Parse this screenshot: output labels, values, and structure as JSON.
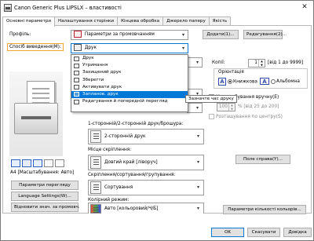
{
  "window": {
    "title": "Canon Generic Plus LIPSLX – властивості",
    "close_glyph": "✕"
  },
  "tabs": [
    {
      "label": "Основні параметри"
    },
    {
      "label": "Налаштування сторінки"
    },
    {
      "label": "Кінцева обробка"
    },
    {
      "label": "Джерело паперу"
    },
    {
      "label": "Якість"
    }
  ],
  "profile": {
    "label": "Профіль:",
    "value": "Параметри за промовчанням",
    "add_button": "Додати(1)...",
    "edit_button": "Редагування(2)..."
  },
  "output": {
    "label": "Спосіб виведення(M):",
    "value": "Друк"
  },
  "output_menu": {
    "items": [
      {
        "label": "Друк"
      },
      {
        "label": "Утримання"
      },
      {
        "label": "Захищений друк"
      },
      {
        "label": "Зберегти"
      },
      {
        "label": "Активувати друк"
      },
      {
        "label": "Запланов. друк"
      },
      {
        "label": "Редагування й попередній перегляд"
      }
    ],
    "selected_index": 5,
    "tooltip": "Зазначте час друку"
  },
  "copies": {
    "label": "Копії:",
    "value": "1",
    "range": "[від 1 до 9999]"
  },
  "orientation": {
    "label": "Орієнтація",
    "portrait_glyph": "A",
    "portrait_label": "Книжкова",
    "landscape_glyph": "A",
    "landscape_label": "Альбомна",
    "selected": "Книжкова"
  },
  "manual_scaling": {
    "label": "Масштабування вручну(E)",
    "value": "100",
    "range": "% [від 25 до 200]",
    "center_label": "Розташування по центру(S)"
  },
  "duplex": {
    "label": "1-сторонній/2-сторонній друк/брошура:",
    "value": "2-сторонній друк"
  },
  "binding": {
    "label": "Місце скріплення:",
    "value": "Довгий край [ліворуч]",
    "margin_button": "Поле справа(Y)..."
  },
  "collate": {
    "label": "Скріплення/сортування/групування:",
    "value": "Сортування"
  },
  "color_mode": {
    "label": "Колірний режим:",
    "value": "Авто [кольоровий/Ч/Б]",
    "color_qty_button": "Параметри кількості кольорів..."
  },
  "preview": {
    "caption": "А4 [Масштабування: Авто]"
  },
  "left_buttons": {
    "page_view": "Параметри перегляду",
    "language": "Language Settings(W)...",
    "restore": "Відновити знач. за промовч."
  },
  "footer": {
    "ok": "OK",
    "cancel": "Скасувати",
    "help": "Довідка"
  },
  "colors": {
    "accent": "#0078d7",
    "highlight_border": "#f0a830",
    "window_bg": "#ffffff"
  }
}
